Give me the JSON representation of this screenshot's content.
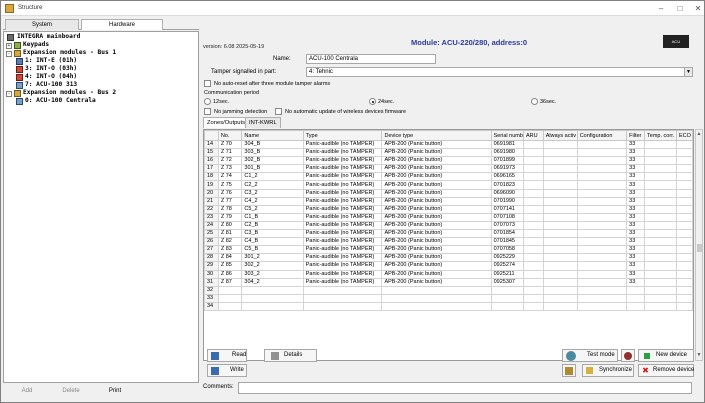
{
  "window": {
    "title": "Structure"
  },
  "left_tabs": [
    "System",
    "Hardware"
  ],
  "tree": [
    {
      "label": "INTEGRA mainboard",
      "level": 0
    },
    {
      "label": "Keypads",
      "level": 0
    },
    {
      "label": "Expansion modules - Bus 1",
      "level": 0
    },
    {
      "label": "1: INT-E      (01h)",
      "level": 1
    },
    {
      "label": "3: INT-O      (03h)",
      "level": 1
    },
    {
      "label": "4: INT-O      (04h)",
      "level": 1
    },
    {
      "label": "7: ACU-100 313",
      "level": 1
    },
    {
      "label": "Expansion modules - Bus 2",
      "level": 0
    },
    {
      "label": "0: ACU-100 Centrala",
      "level": 1
    }
  ],
  "left_buttons": [
    "Add",
    "Delete",
    "Print"
  ],
  "header": {
    "version": "version: 6.08 2025-05-19",
    "module_title": "Module: ACU-220/280, address:0",
    "logo_text": "ACU"
  },
  "form": {
    "name_label": "Name:",
    "name_value": "ACU-100 Centrala",
    "tamper_label": "Tamper signalled in part:",
    "tamper_value": "4: Tehnic",
    "no_autoreset": "No auto-reset after three module tamper alarms",
    "comm_period_label": "Communication period",
    "radio_12": "12sec.",
    "radio_24": "24sec.",
    "radio_36": "36sec.",
    "no_jamming": "No jamming detection",
    "no_auto_update": "No automatic update of wireless devices firmware"
  },
  "right_tabs": [
    "Zones/Outputs",
    "INT-KWRL"
  ],
  "table": {
    "columns": [
      "",
      "No.",
      "Name",
      "Type",
      "Device type",
      "Serial numb",
      "ARU",
      "Always activ",
      "Configuration",
      "Filter",
      "Temp. corr.",
      "ECO"
    ],
    "rows": [
      [
        "14",
        "Z 70",
        "304_B",
        "Panic-audible (no TAMPER)",
        "APB-200 (Panic button)",
        "0691981",
        "",
        "",
        "",
        "33",
        "",
        ""
      ],
      [
        "15",
        "Z 71",
        "303_B",
        "Panic-audible (no TAMPER)",
        "APB-200 (Panic button)",
        "0691980",
        "",
        "",
        "",
        "33",
        "",
        ""
      ],
      [
        "16",
        "Z 72",
        "302_B",
        "Panic-audible (no TAMPER)",
        "APB-200 (Panic button)",
        "0701899",
        "",
        "",
        "",
        "33",
        "",
        ""
      ],
      [
        "17",
        "Z 73",
        "301_B",
        "Panic-audible (no TAMPER)",
        "APB-200 (Panic button)",
        "0691973",
        "",
        "",
        "",
        "33",
        "",
        ""
      ],
      [
        "18",
        "Z 74",
        "C1_2",
        "Panic-audible (no TAMPER)",
        "APB-200 (Panic button)",
        "0696165",
        "",
        "",
        "",
        "33",
        "",
        ""
      ],
      [
        "19",
        "Z 75",
        "C2_2",
        "Panic-audible (no TAMPER)",
        "APB-200 (Panic button)",
        "0701823",
        "",
        "",
        "",
        "33",
        "",
        ""
      ],
      [
        "20",
        "Z 76",
        "C3_2",
        "Panic-audible (no TAMPER)",
        "APB-200 (Panic button)",
        "0696090",
        "",
        "",
        "",
        "33",
        "",
        ""
      ],
      [
        "21",
        "Z 77",
        "C4_2",
        "Panic-audible (no TAMPER)",
        "APB-200 (Panic button)",
        "0701990",
        "",
        "",
        "",
        "33",
        "",
        ""
      ],
      [
        "22",
        "Z 78",
        "C5_2",
        "Panic-audible (no TAMPER)",
        "APB-200 (Panic button)",
        "0707141",
        "",
        "",
        "",
        "33",
        "",
        ""
      ],
      [
        "23",
        "Z 79",
        "C1_B",
        "Panic-audible (no TAMPER)",
        "APB-200 (Panic button)",
        "0707108",
        "",
        "",
        "",
        "33",
        "",
        ""
      ],
      [
        "24",
        "Z 80",
        "C2_B",
        "Panic-audible (no TAMPER)",
        "APB-200 (Panic button)",
        "0707073",
        "",
        "",
        "",
        "33",
        "",
        ""
      ],
      [
        "25",
        "Z 81",
        "C3_B",
        "Panic-audible (no TAMPER)",
        "APB-200 (Panic button)",
        "0701854",
        "",
        "",
        "",
        "33",
        "",
        ""
      ],
      [
        "26",
        "Z 82",
        "C4_B",
        "Panic-audible (no TAMPER)",
        "APB-200 (Panic button)",
        "0701845",
        "",
        "",
        "",
        "33",
        "",
        ""
      ],
      [
        "27",
        "Z 83",
        "C5_B",
        "Panic-audible (no TAMPER)",
        "APB-200 (Panic button)",
        "0707058",
        "",
        "",
        "",
        "33",
        "",
        ""
      ],
      [
        "28",
        "Z 84",
        "301_2",
        "Panic-audible (no TAMPER)",
        "APB-200 (Panic button)",
        "0925229",
        "",
        "",
        "",
        "33",
        "",
        ""
      ],
      [
        "29",
        "Z 85",
        "302_2",
        "Panic-audible (no TAMPER)",
        "APB-200 (Panic button)",
        "0925274",
        "",
        "",
        "",
        "33",
        "",
        ""
      ],
      [
        "30",
        "Z 86",
        "303_2",
        "Panic-audible (no TAMPER)",
        "APB-200 (Panic button)",
        "0925211",
        "",
        "",
        "",
        "33",
        "",
        ""
      ],
      [
        "31",
        "Z 87",
        "304_2",
        "Panic-audible (no TAMPER)",
        "APB-200 (Panic button)",
        "0925307",
        "",
        "",
        "",
        "33",
        "",
        ""
      ],
      [
        "32",
        "",
        "",
        "",
        "",
        "",
        "",
        "",
        "",
        "",
        "",
        ""
      ],
      [
        "33",
        "",
        "",
        "",
        "",
        "",
        "",
        "",
        "",
        "",
        "",
        ""
      ],
      [
        "34",
        "",
        "",
        "",
        "",
        "",
        "",
        "",
        "",
        "",
        "",
        ""
      ]
    ]
  },
  "bottom_buttons": {
    "read": "Read",
    "details": "Details",
    "write": "Write",
    "test_mode": "Test mode",
    "new_device": "New device",
    "synchronize": "Synchronize",
    "remove_device": "Remove device"
  },
  "comments_label": "Comments:"
}
